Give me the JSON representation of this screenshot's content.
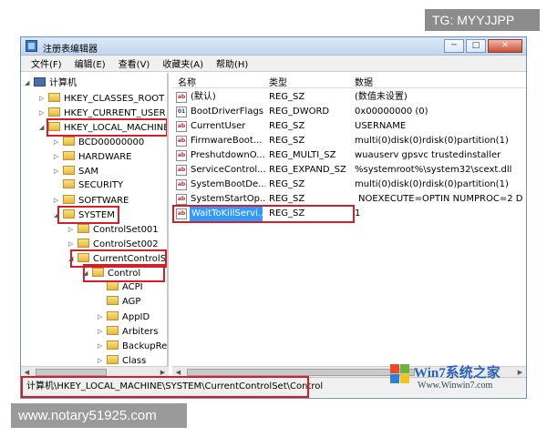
{
  "watermarks": {
    "top": "TG: MYYJJPP",
    "bottom": "www.notary51925.com"
  },
  "window": {
    "title": "注册表编辑器",
    "minimize": "─",
    "maximize": "□",
    "close": "✕"
  },
  "menu": [
    "文件(F)",
    "编辑(E)",
    "查看(V)",
    "收藏夹(A)",
    "帮助(H)"
  ],
  "tree": {
    "root": "计算机",
    "items": [
      "HKEY_CLASSES_ROOT",
      "HKEY_CURRENT_USER",
      "HKEY_LOCAL_MACHINE",
      "BCD00000000",
      "HARDWARE",
      "SAM",
      "SECURITY",
      "SOFTWARE",
      "SYSTEM",
      "ControlSet001",
      "ControlSet002",
      "CurrentControlS",
      "Control",
      "ACPI",
      "AGP",
      "AppID",
      "Arbiters",
      "BackupRe",
      "Class"
    ]
  },
  "list": {
    "columns": [
      "名称",
      "类型",
      "数据"
    ],
    "rows": [
      {
        "name": "(默认)",
        "type": "REG_SZ",
        "data": "(数值未设置)"
      },
      {
        "name": "BootDriverFlags",
        "type": "REG_DWORD",
        "data": "0x00000000 (0)"
      },
      {
        "name": "CurrentUser",
        "type": "REG_SZ",
        "data": "USERNAME"
      },
      {
        "name": "FirmwareBoot...",
        "type": "REG_SZ",
        "data": "multi(0)disk(0)rdisk(0)partition(1)"
      },
      {
        "name": "PreshutdownO...",
        "type": "REG_MULTI_SZ",
        "data": "wuauserv gpsvc trustedinstaller"
      },
      {
        "name": "ServiceControl...",
        "type": "REG_EXPAND_SZ",
        "data": "%systemroot%\\system32\\scext.dll"
      },
      {
        "name": "SystemBootDe...",
        "type": "REG_SZ",
        "data": "multi(0)disk(0)rdisk(0)partition(1)"
      },
      {
        "name": "SystemStartOp...",
        "type": "REG_SZ",
        "data": "NOEXECUTE=OPTIN  NUMPROC=2 D"
      },
      {
        "name": "WaitToKillServi...",
        "type": "REG_SZ",
        "data": "1"
      }
    ]
  },
  "status": "计算机\\HKEY_LOCAL_MACHINE\\SYSTEM\\CurrentControlSet\\Control",
  "logo": {
    "text": "Win7系统之家",
    "url": "Www.Winwin7.com"
  },
  "colors": {
    "highlight": "#d21f2a",
    "selection": "#3399ff"
  }
}
